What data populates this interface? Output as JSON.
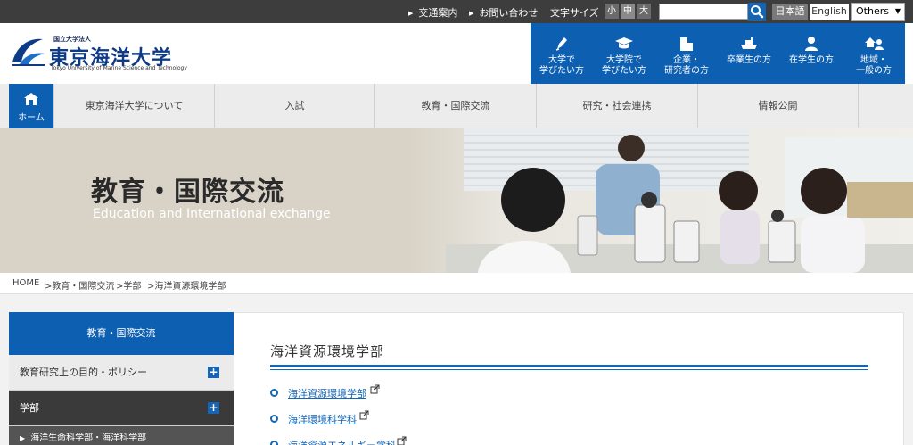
{
  "topbar": {
    "access_label": "交通案内",
    "contact_label": "お問い合わせ",
    "font_size_label": "文字サイズ",
    "font_sizes": [
      "小",
      "中",
      "大"
    ],
    "search_placeholder": "",
    "lang_jp": "日本語",
    "lang_en": "English",
    "others_label": "Others"
  },
  "header": {
    "logo_small": "国立大学法人",
    "logo_main": "東京海洋大学",
    "logo_en": "Tokyo University of Marine Science and Technology",
    "audience": [
      {
        "line1": "大学で",
        "line2": "学びたい方",
        "icon": "pen-icon"
      },
      {
        "line1": "大学院で",
        "line2": "学びたい方",
        "icon": "mortarboard-icon"
      },
      {
        "line1": "企業・",
        "line2": "研究者の方",
        "icon": "building-icon"
      },
      {
        "line1": "卒業生の方",
        "line2": "",
        "icon": "ship-icon"
      },
      {
        "line1": "在学生の方",
        "line2": "",
        "icon": "person-icon"
      },
      {
        "line1": "地域・",
        "line2": "一般の方",
        "icon": "community-icon"
      }
    ]
  },
  "nav": {
    "home": "ホーム",
    "items": [
      "東京海洋大学について",
      "入試",
      "教育・国際交流",
      "研究・社会連携",
      "情報公開"
    ]
  },
  "hero": {
    "title": "教育・国際交流",
    "subtitle": "Education and International exchange"
  },
  "breadcrumb": [
    "HOME",
    ">教育・国際交流",
    ">学部",
    ">海洋資源環境学部"
  ],
  "sidebar": {
    "heading": "教育・国際交流",
    "rows": [
      "教育研究上の目的・ポリシー",
      "学部"
    ],
    "sub": "海洋生命科学部・海洋科学部"
  },
  "main": {
    "title": "海洋資源環境学部",
    "links": [
      "海洋資源環境学部",
      "海洋環境科学科",
      "海洋資源エネルギー学科"
    ]
  },
  "colors": {
    "accent": "#0d5fb2",
    "topbar": "#3d3d3d"
  }
}
